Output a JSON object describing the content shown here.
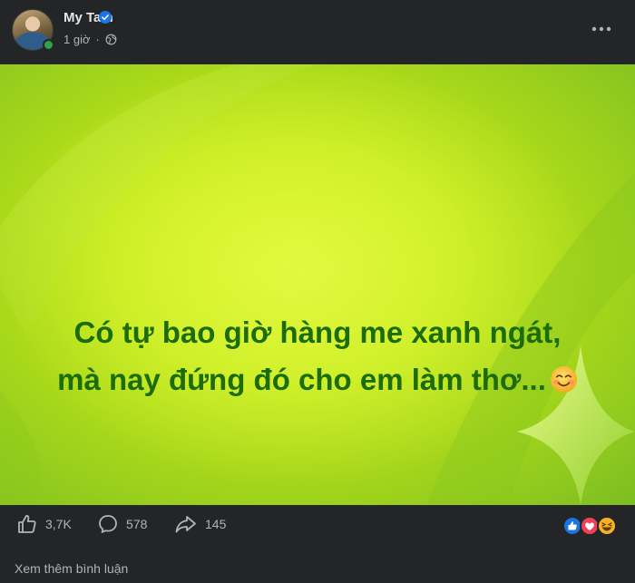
{
  "post": {
    "author": "My Tam",
    "time": "1 giờ",
    "text_line1": "Có tự bao giờ hàng me xanh ngát,",
    "text_line2": "mà nay đứng đó cho em làm thơ...",
    "emoji": "smiling-face-icon",
    "colors": {
      "text": "#1c6d0a",
      "background_start": "#d4f21e",
      "background_end": "#7cbd21"
    }
  },
  "actions": {
    "likes": "3,7K",
    "comments": "578",
    "shares": "145"
  },
  "reactions": [
    "like-icon",
    "love-icon",
    "haha-icon"
  ],
  "comments": {
    "view_more_label": "Xem thêm bình luận"
  }
}
